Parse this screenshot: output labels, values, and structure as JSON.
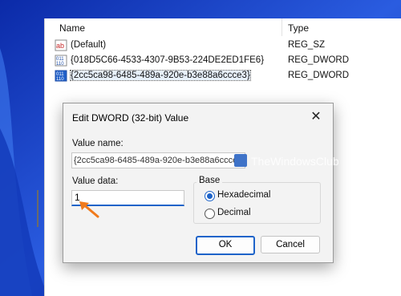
{
  "registry_list": {
    "columns": {
      "name": "Name",
      "type": "Type"
    },
    "rows": [
      {
        "icon": "string-value-icon",
        "name": "(Default)",
        "type": "REG_SZ"
      },
      {
        "icon": "dword-value-icon",
        "name": "{018D5C66-4533-4307-9B53-224DE2ED1FE6}",
        "type": "REG_DWORD"
      },
      {
        "icon": "dword-value-icon",
        "name": "{2cc5ca98-6485-489a-920e-b3e88a6ccce3}",
        "type": "REG_DWORD",
        "selected": true
      }
    ]
  },
  "dialog": {
    "title": "Edit DWORD (32-bit) Value",
    "close_glyph": "✕",
    "value_name_label": "Value name:",
    "value_name_prefix": "{2cc5ca98-6485-489a-920e-b3e88a6ccce",
    "value_name_selected": "3}",
    "value_data_label": "Value data:",
    "value_data": "1",
    "base_label": "Base",
    "base_options": [
      {
        "label": "Hexadecimal",
        "checked": true
      },
      {
        "label": "Decimal",
        "checked": false
      }
    ],
    "ok_label": "OK",
    "cancel_label": "Cancel"
  },
  "watermark": {
    "text": "TheWindowsClub"
  },
  "colors": {
    "accent": "#1d63c9",
    "arrow": "#f07a1c",
    "wallpaper": "#1d3fb8"
  }
}
